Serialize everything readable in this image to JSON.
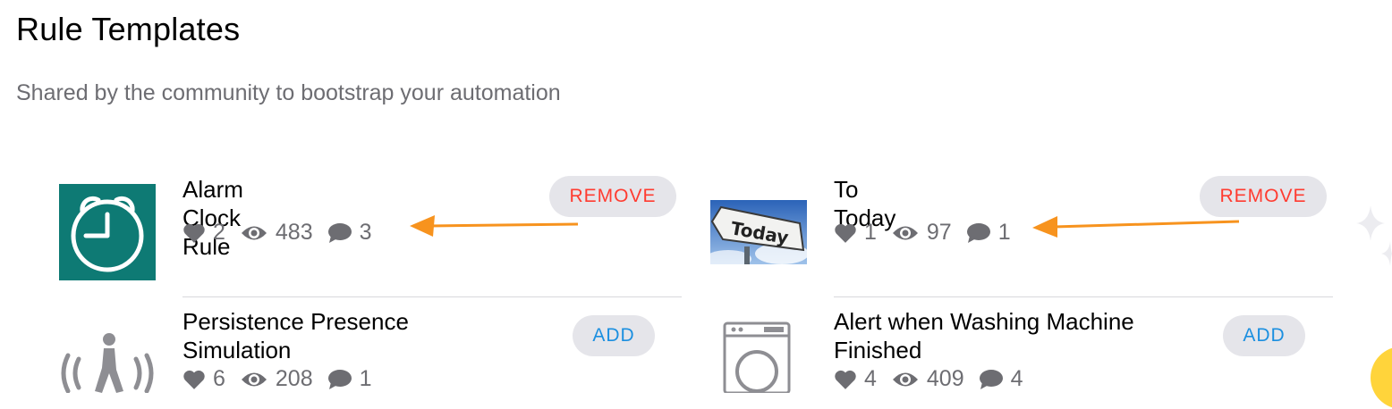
{
  "header": {
    "title": "Rule Templates",
    "subtitle": "Shared by the community to bootstrap your automation"
  },
  "templates": [
    {
      "title": "Alarm Clock Rule",
      "likes": "2",
      "views": "483",
      "comments": "3",
      "action": "REMOVE",
      "icon": "alarm-clock-icon"
    },
    {
      "title": "To Today",
      "likes": "1",
      "views": "97",
      "comments": "1",
      "action": "REMOVE",
      "icon": "today-sign-image"
    },
    {
      "title": "Persistence Presence Simulation",
      "likes": "6",
      "views": "208",
      "comments": "1",
      "action": "ADD",
      "icon": "presence-walker-icon"
    },
    {
      "title": "Alert when Washing Machine Finished",
      "likes": "4",
      "views": "409",
      "comments": "4",
      "action": "ADD",
      "icon": "washing-machine-icon"
    }
  ],
  "colors": {
    "remove": "#ff3b30",
    "add": "#1b8fe0",
    "pill_bg": "#e5e5ea",
    "annotation_arrow": "#f7931e",
    "alarm_tile": "#0e7a74"
  }
}
